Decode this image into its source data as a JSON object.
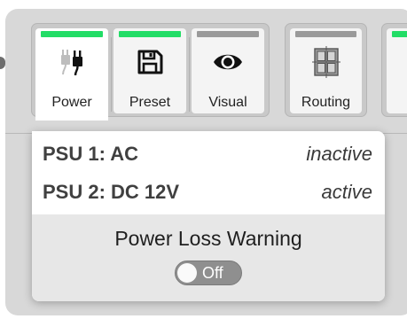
{
  "toolbar": {
    "buttons": [
      {
        "label": "Power",
        "indicator_color": "#22dd66",
        "icon": "plug-icon",
        "active": true
      },
      {
        "label": "Preset",
        "indicator_color": "#22dd66",
        "icon": "floppy-disk-icon",
        "active": false
      },
      {
        "label": "Visual",
        "indicator_color": "#9a9a9a",
        "icon": "eye-icon",
        "active": false
      },
      {
        "label": "Routing",
        "indicator_color": "#9a9a9a",
        "icon": "routing-grid-icon",
        "active": false
      },
      {
        "label": "",
        "indicator_color": "#22dd66",
        "icon": "",
        "active": false
      }
    ]
  },
  "power_popup": {
    "psu": [
      {
        "name": "PSU 1: AC",
        "status": "inactive"
      },
      {
        "name": "PSU 2: DC 12V",
        "status": "active"
      }
    ],
    "power_loss_warning": {
      "title": "Power Loss Warning",
      "toggle_label": "Off"
    }
  }
}
